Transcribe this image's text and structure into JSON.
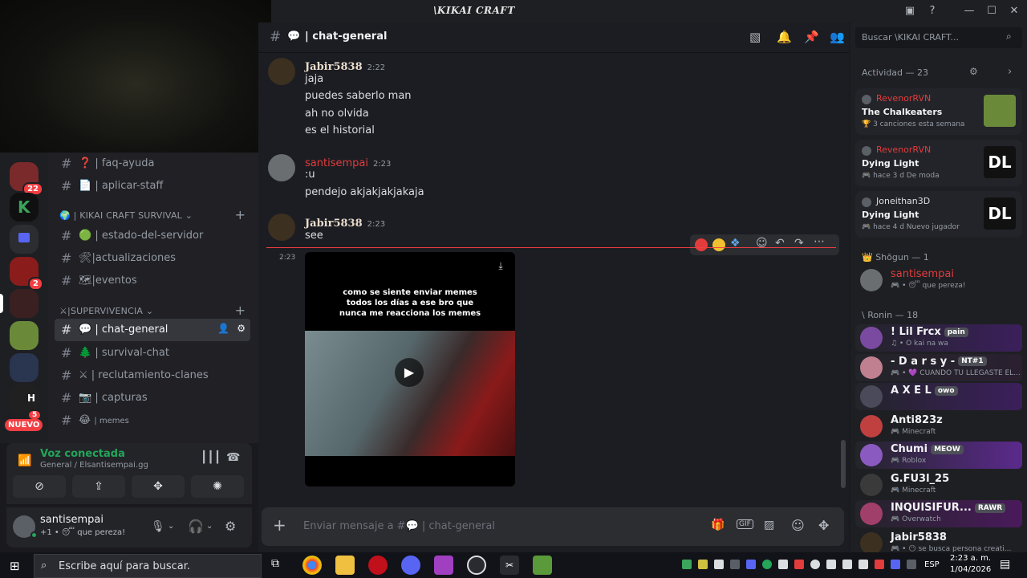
{
  "window": {
    "title": "\\KIKAI CRAFT"
  },
  "servers": [
    {
      "badge": "22",
      "color": "#7a2a2a"
    },
    {
      "badge": "",
      "color": "#101010"
    },
    {
      "badge": "",
      "color": "#2b2d31"
    },
    {
      "badge": "2",
      "color": "#8a1c1c"
    },
    {
      "badge": "",
      "color": "#3a2020"
    },
    {
      "badge": "",
      "color": "#6a8a3a"
    },
    {
      "badge": "",
      "color": "#2a3550"
    },
    {
      "badge": "",
      "color": "#202020"
    }
  ],
  "new_label": "NUEVO",
  "new_count": "5",
  "channels": {
    "top": [
      {
        "label": "| faq-ayuda",
        "emoji": "❓"
      },
      {
        "label": "| aplicar-staff",
        "emoji": "📄"
      }
    ],
    "cat1": "| KIKAI CRAFT SURVIVAL",
    "cat1_items": [
      {
        "label": "| estado-del-servidor",
        "emoji": "🟢"
      },
      {
        "label": "|actualizaciones",
        "emoji": "🛠"
      },
      {
        "label": "|eventos",
        "emoji": "🗺"
      }
    ],
    "cat2": "⚔|SUPERVIVENCIA",
    "cat2_items": [
      {
        "label": "| chat-general",
        "emoji": "💬"
      },
      {
        "label": "| survival-chat",
        "emoji": "🌲"
      },
      {
        "label": "| reclutamiento-clanes",
        "emoji": "⚔"
      },
      {
        "label": "| capturas",
        "emoji": "📷"
      },
      {
        "label": "| memes",
        "emoji": "😂"
      }
    ]
  },
  "voice": {
    "status": "Voz conectada",
    "location": "General / Elsantisempai.gg"
  },
  "user": {
    "name": "santisempai",
    "status": "+1 • 😴 que pereza!"
  },
  "chat": {
    "channel": "| chat-general",
    "messages": [
      {
        "author": "Jabir5838",
        "time": "2:22",
        "color": "#e9dccc",
        "lines": [
          "jaja",
          "puedes saberlo man",
          "ah no olvida",
          "es el historial"
        ]
      },
      {
        "author": "santisempai",
        "time": "2:23",
        "color": "#e23c3c",
        "lines": [
          ":u",
          "pendejo akjakjakjakaja"
        ]
      },
      {
        "author": "Jabir5838",
        "time": "2:23",
        "color": "#e9dccc",
        "lines": [
          "see"
        ]
      }
    ],
    "media_time": "2:23",
    "meme_caption": "como se siente enviar memes todos los días a ese bro que nunca me reacciona los memes",
    "input_placeholder": "Enviar mensaje a #💬 | chat-general"
  },
  "members": {
    "header": "Buscar \\KIKAI CRAFT...",
    "activity_title": "Actividad — 23",
    "activities": [
      {
        "user": "RevenorRVN",
        "user_color": "#e23c3c",
        "game": "The Chalkeaters",
        "detail": "3 canciones esta semana",
        "thumb": "#6a8a3a"
      },
      {
        "user": "RevenorRVN",
        "user_color": "#e23c3c",
        "game": "Dying Light",
        "detail": "hace 3 d   De moda",
        "thumb": "#111111"
      },
      {
        "user": "Joneithan3D",
        "user_color": "#dbdee1",
        "game": "Dying Light",
        "detail": "hace 4 d   Nuevo jugador",
        "thumb": "#111111"
      }
    ],
    "group1": "Shōgun — 1",
    "shogun": {
      "name": "santisempai",
      "status": "🎮 • 😴 que pereza!"
    },
    "group2": "Ronin — 18",
    "ronin": [
      {
        "name": "! Lil Frcx",
        "tag": "pain",
        "status": "♫ • O kai na wa",
        "bg": "#3b1f5c"
      },
      {
        "name": "- D a r s y -",
        "tag": "NT#1",
        "status": "🎮 • 💜 CUANDO TU LLEGASTE EL...",
        "bg": "#2a2030"
      },
      {
        "name": "A X E L",
        "tag": "owo",
        "status": "",
        "bg": "#3b1f5c"
      },
      {
        "name": "Anti823z",
        "tag": "",
        "status": "🎮 Minecraft",
        "bg": ""
      },
      {
        "name": "Chumi",
        "tag": "MEOW",
        "status": "🎮 Roblox",
        "bg": "#5b2a8c"
      },
      {
        "name": "G.FU3l_25",
        "tag": "",
        "status": "🎮 Minecraft",
        "bg": ""
      },
      {
        "name": "INQUISIFUR...",
        "tag": "RAWR",
        "status": "🎮 Overwatch",
        "bg": "#4a1a5c"
      },
      {
        "name": "Jabir5838",
        "tag": "",
        "status": "🎮 • 😶 se busca persona creati...",
        "bg": ""
      }
    ]
  },
  "taskbar": {
    "search_placeholder": "Escribe aquí para buscar.",
    "lang": "ESP",
    "time": "2:23 a. m.",
    "date": "1/04/2026"
  }
}
